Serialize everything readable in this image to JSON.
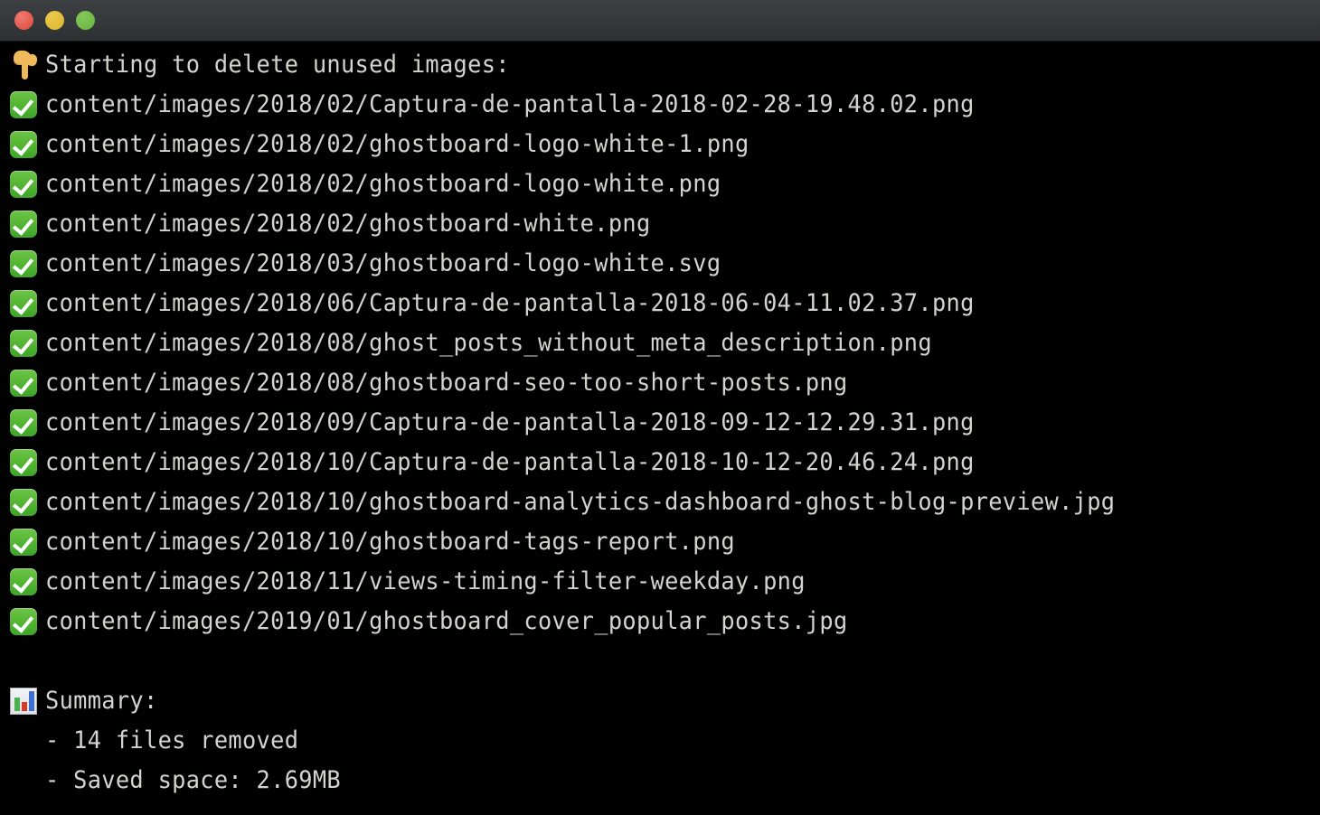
{
  "window": {
    "title": "",
    "controls": [
      {
        "name": "close",
        "color": "#e2574c"
      },
      {
        "name": "minimize",
        "color": "#e0bb36"
      },
      {
        "name": "maximize",
        "color": "#6fb945"
      }
    ],
    "background_color": "#010101",
    "text_color": "#d3d3cf",
    "titlebar_color": "#35383b"
  },
  "terminal": {
    "header": {
      "icon": "point-down-emoji",
      "text": "Starting to delete unused images:"
    },
    "files": [
      {
        "icon": "check-mark-button-emoji",
        "path": "content/images/2018/02/Captura-de-pantalla-2018-02-28-19.48.02.png"
      },
      {
        "icon": "check-mark-button-emoji",
        "path": "content/images/2018/02/ghostboard-logo-white-1.png"
      },
      {
        "icon": "check-mark-button-emoji",
        "path": "content/images/2018/02/ghostboard-logo-white.png"
      },
      {
        "icon": "check-mark-button-emoji",
        "path": "content/images/2018/02/ghostboard-white.png"
      },
      {
        "icon": "check-mark-button-emoji",
        "path": "content/images/2018/03/ghostboard-logo-white.svg"
      },
      {
        "icon": "check-mark-button-emoji",
        "path": "content/images/2018/06/Captura-de-pantalla-2018-06-04-11.02.37.png"
      },
      {
        "icon": "check-mark-button-emoji",
        "path": "content/images/2018/08/ghost_posts_without_meta_description.png"
      },
      {
        "icon": "check-mark-button-emoji",
        "path": "content/images/2018/08/ghostboard-seo-too-short-posts.png"
      },
      {
        "icon": "check-mark-button-emoji",
        "path": "content/images/2018/09/Captura-de-pantalla-2018-09-12-12.29.31.png"
      },
      {
        "icon": "check-mark-button-emoji",
        "path": "content/images/2018/10/Captura-de-pantalla-2018-10-12-20.46.24.png"
      },
      {
        "icon": "check-mark-button-emoji",
        "path": "content/images/2018/10/ghostboard-analytics-dashboard-ghost-blog-preview.jpg"
      },
      {
        "icon": "check-mark-button-emoji",
        "path": "content/images/2018/10/ghostboard-tags-report.png"
      },
      {
        "icon": "check-mark-button-emoji",
        "path": "content/images/2018/11/views-timing-filter-weekday.png"
      },
      {
        "icon": "check-mark-button-emoji",
        "path": "content/images/2019/01/ghostboard_cover_popular_posts.jpg"
      }
    ],
    "summary": {
      "icon": "bar-chart-emoji",
      "heading": "Summary:",
      "lines": [
        "- 14 files removed",
        "- Saved space: 2.69MB"
      ],
      "files_removed": "14",
      "saved_space": "2.69MB"
    }
  }
}
